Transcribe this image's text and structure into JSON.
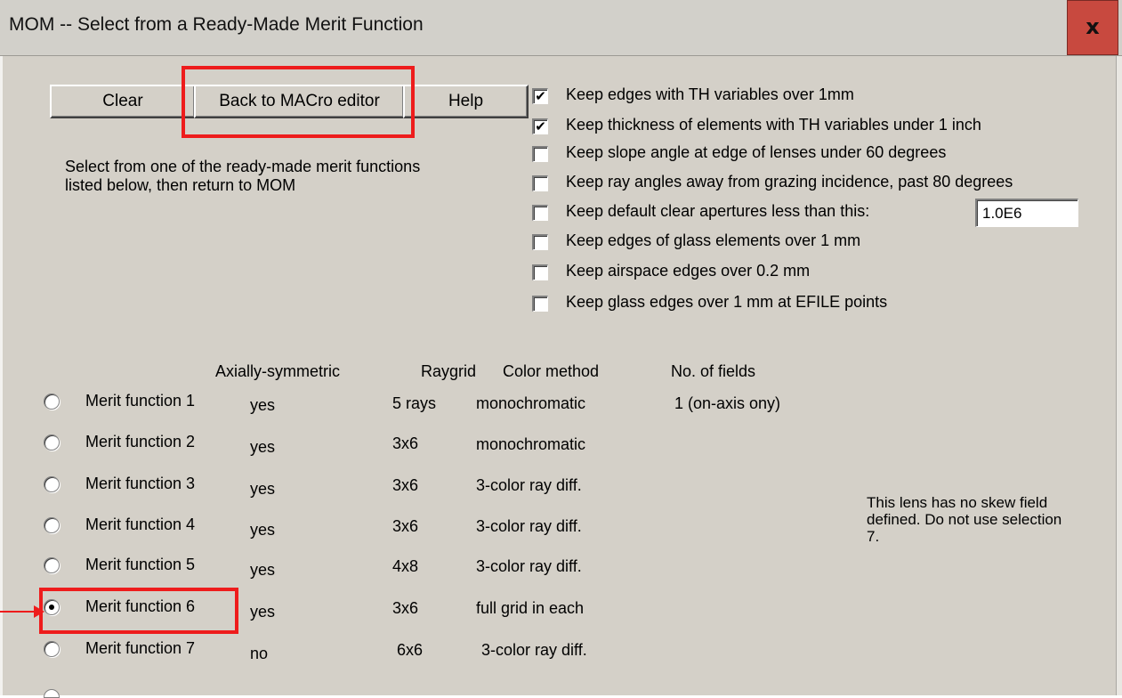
{
  "window": {
    "title": "MOM -- Select from a Ready-Made Merit Function",
    "close_label": "x"
  },
  "buttons": {
    "clear": "Clear",
    "back": "Back to MACro editor",
    "help": "Help"
  },
  "description": "Select from one of the ready-made merit functions listed below, then return to MOM",
  "checkboxes": [
    {
      "label": "Keep edges with TH variables over 1mm",
      "checked": true
    },
    {
      "label": "Keep thickness of elements with TH variables under 1 inch",
      "checked": true
    },
    {
      "label": "Keep slope angle at edge of lenses under 60 degrees",
      "checked": false
    },
    {
      "label": "Keep ray angles away from grazing incidence, past 80 degrees",
      "checked": false
    },
    {
      "label": "Keep default clear apertures less than this:",
      "checked": false
    },
    {
      "label": "Keep edges of glass elements over 1 mm",
      "checked": false
    },
    {
      "label": "Keep airspace edges over 0.2 mm",
      "checked": false
    },
    {
      "label": "Keep glass edges over 1 mm at EFILE points",
      "checked": false
    }
  ],
  "aperture_value": "1.0E6",
  "table": {
    "headers": {
      "axial": "Axially-symmetric",
      "raygrid": "Raygrid",
      "color": "Color method",
      "fields": "No. of fields"
    },
    "rows": [
      {
        "label": "Merit function 1",
        "axial": "yes",
        "raygrid": "5 rays",
        "color": "monochromatic",
        "fields": "1 (on-axis ony)",
        "selected": false
      },
      {
        "label": "Merit function 2",
        "axial": "yes",
        "raygrid": "3x6",
        "color": "monochromatic",
        "fields": "",
        "selected": false
      },
      {
        "label": "Merit function 3",
        "axial": "yes",
        "raygrid": "3x6",
        "color": "3-color ray diff.",
        "fields": "",
        "selected": false
      },
      {
        "label": "Merit function 4",
        "axial": "yes",
        "raygrid": "3x6",
        "color": "3-color ray diff.",
        "fields": "",
        "selected": false
      },
      {
        "label": "Merit function 5",
        "axial": "yes",
        "raygrid": "4x8",
        "color": "3-color ray diff.",
        "fields": "",
        "selected": false
      },
      {
        "label": "Merit function 6",
        "axial": "yes",
        "raygrid": "3x6",
        "color": "full grid in each",
        "fields": "",
        "selected": true
      },
      {
        "label": "Merit function 7",
        "axial": "no",
        "raygrid": "6x6",
        "color": "3-color ray diff.",
        "fields": "",
        "selected": false
      }
    ]
  },
  "note": "This lens has no skew field defined.  Do not use selection 7.",
  "colors": {
    "highlight": "#ee1c1c",
    "dialog_bg": "#d4d0c8",
    "close_bg": "#c8493f"
  }
}
